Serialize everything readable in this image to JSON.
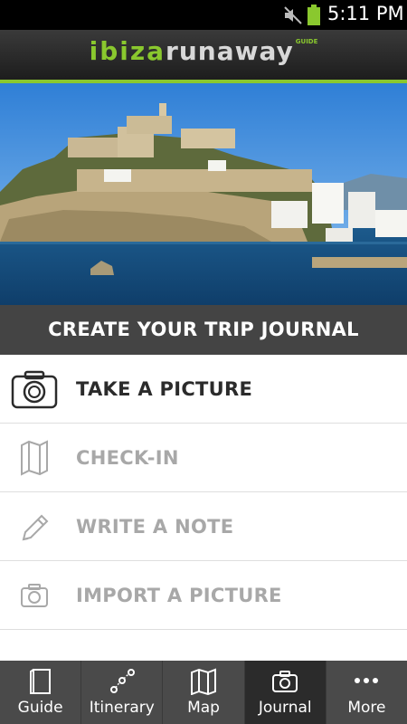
{
  "status_bar": {
    "time": "5:11 PM",
    "icons": [
      "mute-icon",
      "battery-icon"
    ],
    "battery_color": "#8ac82e"
  },
  "header": {
    "logo_part1": "ibiza",
    "logo_part2": "runaway",
    "logo_part3": "GUIDE",
    "accent_color": "#8ac82e"
  },
  "hero": {
    "subject": "Ibiza old town coastline photo"
  },
  "journal": {
    "title": "CREATE YOUR TRIP JOURNAL",
    "actions": [
      {
        "label": "TAKE A PICTURE",
        "icon": "camera-icon",
        "active": true
      },
      {
        "label": "CHECK-IN",
        "icon": "map-icon",
        "active": false
      },
      {
        "label": "WRITE A NOTE",
        "icon": "pencil-icon",
        "active": false
      },
      {
        "label": "IMPORT A PICTURE",
        "icon": "camera-small-icon",
        "active": false
      }
    ]
  },
  "bottom_nav": {
    "tabs": [
      {
        "label": "Guide",
        "icon": "book-icon",
        "active": false
      },
      {
        "label": "Itinerary",
        "icon": "route-icon",
        "active": false
      },
      {
        "label": "Map",
        "icon": "map-icon",
        "active": false
      },
      {
        "label": "Journal",
        "icon": "camera-icon",
        "active": true
      },
      {
        "label": "More",
        "icon": "more-dots-icon",
        "active": false
      }
    ]
  }
}
